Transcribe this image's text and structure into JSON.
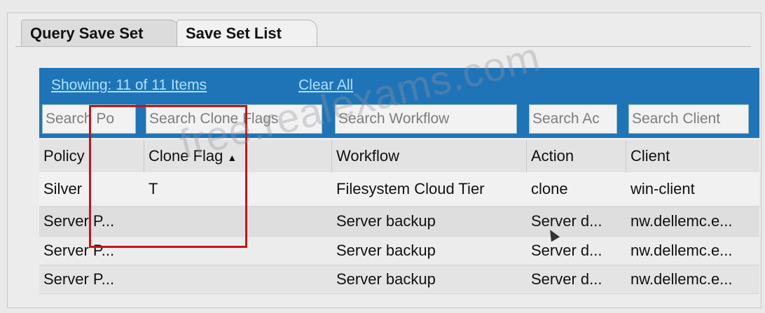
{
  "tabs": [
    {
      "label": "Query Save Set",
      "active": false
    },
    {
      "label": "Save Set List",
      "active": true
    }
  ],
  "toolbar": {
    "showing": "Showing: 11 of 11 Items",
    "clear_all": "Clear All",
    "search_placeholders": {
      "policy": "Search Po",
      "clone_flags": "Search Clone Flags",
      "workflow": "Search Workflow",
      "action": "Search Ac",
      "client": "Search Client"
    }
  },
  "table": {
    "columns": [
      "Policy",
      "Clone Flag",
      "Workflow",
      "Action",
      "Client"
    ],
    "sort_indicator": "▲",
    "rows": [
      {
        "policy": "Silver",
        "clone_flag": "T",
        "workflow": "Filesystem Cloud Tier",
        "action": "clone",
        "client": "win-client"
      },
      {
        "policy": "Server P...",
        "clone_flag": "",
        "workflow": "Server backup",
        "action": "Server d...",
        "client": "nw.dellemc.e..."
      },
      {
        "policy": "Server P...",
        "clone_flag": "",
        "workflow": "Server backup",
        "action": "Server d...",
        "client": "nw.dellemc.e..."
      },
      {
        "policy": "Server P...",
        "clone_flag": "",
        "workflow": "Server backup",
        "action": "Server d...",
        "client": "nw.dellemc.e..."
      }
    ]
  },
  "watermark": "free.realexams.com",
  "colors": {
    "toolbar_bg": "#1f74b7",
    "highlight_box": "#c0161b",
    "link": "#aee0ff"
  }
}
